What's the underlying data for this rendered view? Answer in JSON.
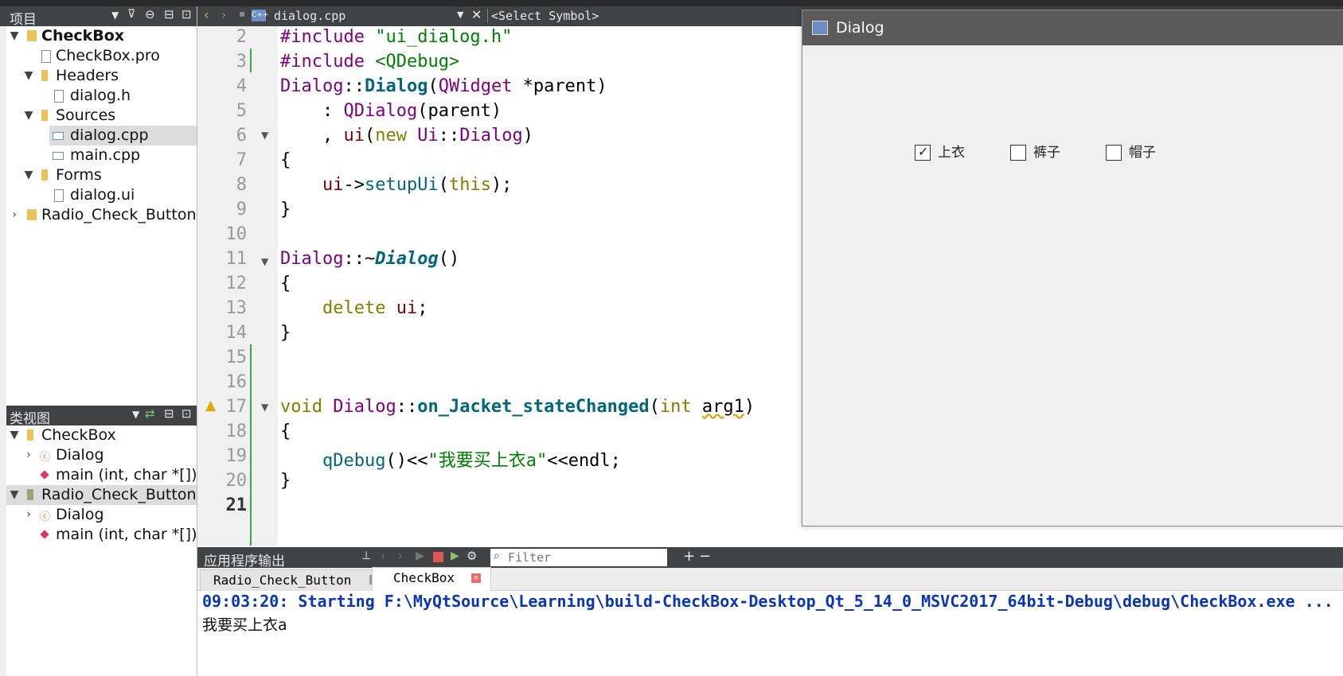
{
  "left_top_pane": {
    "title": "项目",
    "tree": [
      {
        "label": "CheckBox",
        "bold": true
      },
      {
        "label": "CheckBox.pro"
      },
      {
        "label": "Headers"
      },
      {
        "label": "dialog.h"
      },
      {
        "label": "Sources"
      },
      {
        "label": "dialog.cpp"
      },
      {
        "label": "main.cpp"
      },
      {
        "label": "Forms"
      },
      {
        "label": "dialog.ui"
      },
      {
        "label": "Radio_Check_Button"
      }
    ]
  },
  "left_bottom_pane": {
    "title": "类视图",
    "tree": [
      {
        "label": "CheckBox"
      },
      {
        "label": "Dialog"
      },
      {
        "label": "main (int, char *[])"
      },
      {
        "label": "Radio_Check_Button"
      },
      {
        "label": "Dialog"
      },
      {
        "label": "main (int, char *[])"
      }
    ]
  },
  "editor": {
    "file_name": "dialog.cpp",
    "symbol_selector": "<Select Symbol>",
    "line_numbers": [
      "2",
      "3",
      "4",
      "5",
      "6",
      "7",
      "8",
      "9",
      "10",
      "11",
      "12",
      "13",
      "14",
      "15",
      "16",
      "17",
      "18",
      "19",
      "20",
      "21"
    ],
    "code": {
      "l2_kw": "#include",
      "l2_str": "\"ui_dialog.h\"",
      "l3_kw": "#include",
      "l3_str": "<QDebug>",
      "l4_a": "Dialog",
      "l4_b": "::",
      "l4_c": "Dialog",
      "l4_d": "(",
      "l4_e": "QWidget",
      "l4_f": " *parent)",
      "l5_a": "    : ",
      "l5_b": "QDialog",
      "l5_c": "(parent)",
      "l6_a": "    , ",
      "l6_b": "ui",
      "l6_c": "(",
      "l6_d": "new",
      "l6_e": " ",
      "l6_f": "Ui",
      "l6_g": "::",
      "l6_h": "Dialog",
      "l6_i": ")",
      "l7": "{",
      "l8_a": "    ",
      "l8_b": "ui",
      "l8_c": "->",
      "l8_d": "setupUi",
      "l8_e": "(",
      "l8_f": "this",
      "l8_g": ");",
      "l9": "}",
      "l11_a": "Dialog",
      "l11_b": "::~",
      "l11_c": "Dialog",
      "l11_d": "()",
      "l12": "{",
      "l13_a": "    ",
      "l13_b": "delete",
      "l13_c": " ",
      "l13_d": "ui",
      "l13_e": ";",
      "l14": "}",
      "l17_a": "void",
      "l17_b": " ",
      "l17_c": "Dialog",
      "l17_d": "::",
      "l17_e": "on_Jacket_stateChanged",
      "l17_f": "(",
      "l17_g": "int",
      "l17_h": " ",
      "l17_i": "arg1",
      "l17_j": ")",
      "l18": "{",
      "l19_a": "    ",
      "l19_b": "qDebug",
      "l19_c": "()<<",
      "l19_d": "\"我要买上衣a\"",
      "l19_e": "<<endl;",
      "l20": "}"
    }
  },
  "dialog_window": {
    "title": "Dialog",
    "checkboxes": [
      {
        "label": "上衣",
        "checked": true
      },
      {
        "label": "裤子",
        "checked": false
      },
      {
        "label": "帽子",
        "checked": false
      }
    ]
  },
  "output_pane": {
    "title": "应用程序输出",
    "filter_placeholder": "Filter",
    "tabs": [
      {
        "label": "Radio_Check_Button",
        "active": false
      },
      {
        "label": "CheckBox",
        "active": true
      }
    ],
    "lines": [
      "09:03:20: Starting F:\\MyQtSource\\Learning\\build-CheckBox-Desktop_Qt_5_14_0_MSVC2017_64bit-Debug\\debug\\CheckBox.exe ...",
      "我要买上衣a"
    ]
  },
  "colors": {
    "toolbar_dark": "#404244",
    "keyword": "#808000",
    "class": "#800080",
    "function": "#00677c",
    "string": "#008000",
    "output_blue": "#0a35b5"
  }
}
